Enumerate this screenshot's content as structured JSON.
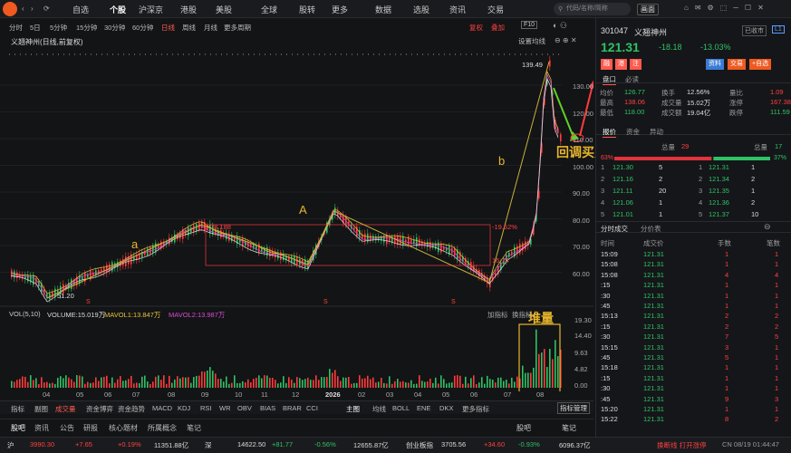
{
  "nav": {
    "tabs": [
      "自选",
      "个股",
      "沪深京",
      "港股",
      "美股",
      "全球",
      "股转",
      "更多",
      "数据",
      "选股",
      "资讯",
      "交易"
    ],
    "active": 1,
    "search_placeholder": "代码/名称/简称",
    "screen_label": "画面"
  },
  "toolbar": {
    "periods": [
      "分时",
      "5日",
      "5分钟",
      "15分钟",
      "30分钟",
      "60分钟",
      "日线",
      "周线",
      "月线",
      "更多周期"
    ],
    "active": 6,
    "fuquan": "复权",
    "overlay": "叠加",
    "f10": "F10"
  },
  "chart": {
    "title": "义翘神州(日线,前复权)",
    "settings": "设置均线",
    "high_label": "139.49",
    "low_label": "51.20",
    "box_left_label": "78.188",
    "box_right_label": "-19.52%",
    "box_bottom_label": "16.74",
    "annot_a": "a",
    "annot_A": "A",
    "annot_b": "b",
    "annot_buy": "回调买点",
    "annot_vol": "堆量",
    "s_marks": [
      "S",
      "S",
      "S"
    ],
    "price_axis": [
      "130.00",
      "120.00",
      "110.00",
      "100.00",
      "90.00",
      "80.00",
      "70.00",
      "60.00"
    ],
    "month_axis": [
      "04",
      "05",
      "06",
      "07",
      "08",
      "09",
      "10",
      "11",
      "12",
      "2026",
      "02",
      "03",
      "04",
      "05",
      "06",
      "07",
      "08"
    ]
  },
  "volume": {
    "label": "VOL(5,10)",
    "volume": "VOLUME:15.019万",
    "mavol1": "MAVOL1:13.847万",
    "mavol2": "MAVOL2:13.987万",
    "add_ind": "加指标",
    "switch_ind": "换指标",
    "axis": [
      "19.30",
      "14.40",
      "9.63",
      "4.82",
      "0.00"
    ]
  },
  "indicator_tabs": [
    "指标",
    "副图",
    "成交量",
    "资金博弈",
    "资金趋势",
    "MACD",
    "KDJ",
    "RSI",
    "WR",
    "OBV",
    "BIAS",
    "BRAR",
    "CCI",
    "主图",
    "均线",
    "BOLL",
    "ENE",
    "DKX",
    "更多指标"
  ],
  "indicator_manage": "指标管理",
  "sub_tabs": [
    "股吧",
    "资讯",
    "公告",
    "研报",
    "核心题材",
    "所属概念",
    "笔记"
  ],
  "sub_right": [
    "股吧",
    "笔记"
  ],
  "status": [
    {
      "name": "沪",
      "value": "3990.30",
      "chg": "+7.65",
      "pct": "+0.19%",
      "amt": "11351.88亿"
    },
    {
      "name": "深",
      "value": "14622.50",
      "chg": "+81.77",
      "pct": "-0.56%",
      "amt": "12655.87亿"
    },
    {
      "name": "创业板指",
      "value": "3705.56",
      "chg": "+34.60",
      "pct": "-0.93%",
      "amt": "6096.37亿"
    }
  ],
  "status_right": [
    "换断线 打开涨停",
    "CN 08/19 01:44:47"
  ],
  "stock": {
    "code": "301047",
    "name": "义翘神州",
    "tag": "已收市",
    "level": "L1",
    "price": "121.31",
    "chg": "-18.18",
    "pct": "-13.03%",
    "badges": [
      "融",
      "港",
      "注"
    ],
    "actions": [
      "资料",
      "交易",
      "+自选"
    ]
  },
  "panel_tabs": [
    "盘口",
    "必读"
  ],
  "quote": [
    [
      "均价",
      "126.77",
      "换手",
      "12.56%",
      "量比",
      "1.09"
    ],
    [
      "最高",
      "138.06",
      "成交量",
      "15.02万",
      "涨停",
      "167.38"
    ],
    [
      "最低",
      "118.00",
      "成交额",
      "19.04亿",
      "跌停",
      "111.59"
    ]
  ],
  "order_tabs": [
    "报价",
    "资金",
    "异动"
  ],
  "order": {
    "total_buy_label": "总量",
    "total_buy": "29",
    "total_sell_label": "总量",
    "total_sell": "17",
    "pct_left": "63%",
    "pct_right": "37%"
  },
  "bids": [
    [
      "1",
      "121.30",
      "5"
    ],
    [
      "2",
      "121.16",
      "2"
    ],
    [
      "3",
      "121.11",
      "20"
    ],
    [
      "4",
      "121.06",
      "1"
    ],
    [
      "5",
      "121.01",
      "1"
    ]
  ],
  "asks": [
    [
      "1",
      "121.31",
      "1"
    ],
    [
      "2",
      "121.34",
      "2"
    ],
    [
      "3",
      "121.35",
      "1"
    ],
    [
      "4",
      "121.36",
      "2"
    ],
    [
      "5",
      "121.37",
      "10"
    ]
  ],
  "trade_tabs": [
    "分时成交",
    "分价表"
  ],
  "trade_header": [
    "时间",
    "成交价",
    "手数",
    "笔数"
  ],
  "trades": [
    [
      "15:09",
      "121.31",
      "1",
      "1"
    ],
    [
      "15:08",
      "121.31",
      "1",
      "1"
    ],
    [
      "15:08",
      "121.31",
      "4",
      "4"
    ],
    [
      ":15",
      "121.31",
      "1",
      "1"
    ],
    [
      ":30",
      "121.31",
      "1",
      "1"
    ],
    [
      ":45",
      "121.31",
      "1",
      "1"
    ],
    [
      "15:13",
      "121.31",
      "2",
      "2"
    ],
    [
      ":15",
      "121.31",
      "2",
      "2"
    ],
    [
      ":30",
      "121.31",
      "7",
      "5"
    ],
    [
      "15:15",
      "121.31",
      "3",
      "1"
    ],
    [
      ":45",
      "121.31",
      "5",
      "1"
    ],
    [
      "15:18",
      "121.31",
      "1",
      "1"
    ],
    [
      ":15",
      "121.31",
      "1",
      "1"
    ],
    [
      ":30",
      "121.31",
      "1",
      "1"
    ],
    [
      ":45",
      "121.31",
      "9",
      "3"
    ],
    [
      "15:20",
      "121.31",
      "1",
      "1"
    ],
    [
      "15:22",
      "121.31",
      "8",
      "2"
    ]
  ]
}
